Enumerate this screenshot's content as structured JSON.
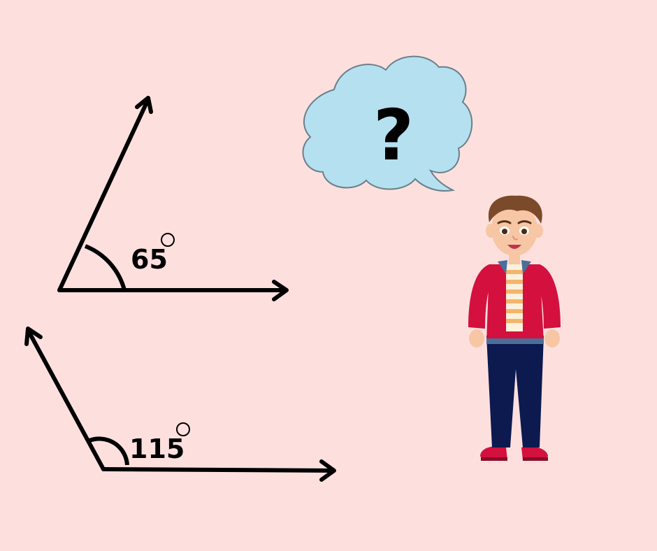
{
  "angles": [
    {
      "value": 65,
      "label": "65",
      "unit": "degree"
    },
    {
      "value": 115,
      "label": "115",
      "unit": "degree"
    }
  ],
  "thought_bubble": {
    "symbol": "?",
    "fill_color": "#b5e0ef",
    "stroke_color": "#6a7f8a"
  },
  "character": {
    "icon": "boy-character",
    "jacket_color": "#d3103e",
    "pants_color": "#0c1a4f",
    "hair_color": "#7a4a2b",
    "shirt_stripe_color": "#f3b56d"
  },
  "colors": {
    "background": "#fde0de",
    "line": "#000000"
  }
}
